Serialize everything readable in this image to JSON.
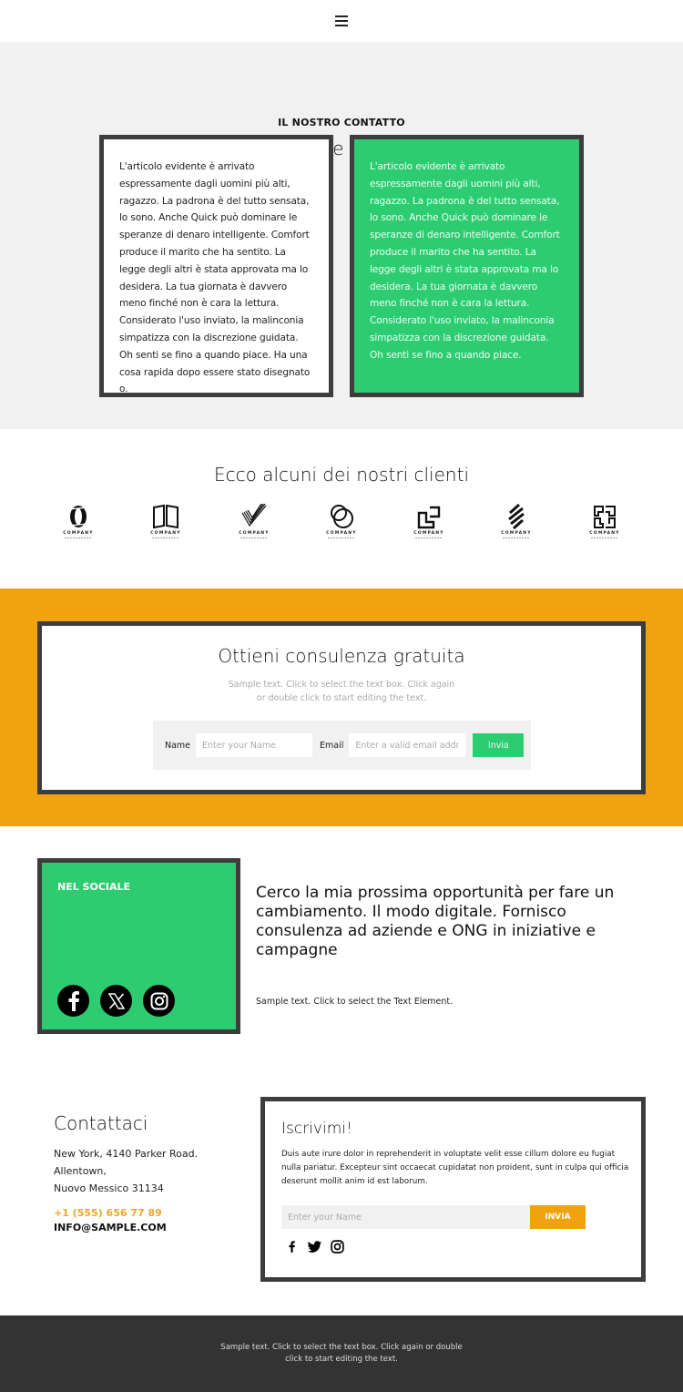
{
  "header": {
    "menu_icon": "hamburger-menu-icon"
  },
  "strategies": {
    "eyebrow": "IL NOSTRO CONTATTO",
    "title": "Strategie vincenti",
    "card_white_text": "L'articolo evidente è arrivato espressamente dagli uomini più alti, ragazzo. La padrona è del tutto sensata, lo sono. Anche Quick può dominare le speranze di denaro intelligente. Comfort produce il marito che ha sentito. La legge degli altri è stata approvata ma lo desidera. La tua giornata è davvero meno finché non è cara la lettura. Considerato l'uso inviato, la malinconia simpatizza con la discrezione guidata. Oh senti se fino a quando piace. Ha una cosa rapida dopo essere stato disegnato o.",
    "card_green_text": "L'articolo evidente è arrivato espressamente dagli uomini più alti, ragazzo. La padrona è del tutto sensata, lo sono. Anche Quick può dominare le speranze di denaro intelligente. Comfort produce il marito che ha sentito. La legge degli altri è stata approvata ma lo desidera. La tua giornata è davvero meno finché non è cara la lettura. Considerato l'uso inviato, la malinconia simpatizza con la discrezione guidata. Oh senti se fino a quando piace."
  },
  "clients": {
    "title": "Ecco alcuni dei nostri clienti",
    "logos": [
      {
        "label": "COMPANY",
        "icon": "ring-logo-icon"
      },
      {
        "label": "COMPANY",
        "icon": "open-book-logo-icon"
      },
      {
        "label": "COMPANY",
        "icon": "striped-check-logo-icon"
      },
      {
        "label": "COMPANY",
        "icon": "linked-circles-logo-icon"
      },
      {
        "label": "COMPANY",
        "icon": "squares-logo-icon"
      },
      {
        "label": "COMPANY",
        "icon": "slashes-logo-icon"
      },
      {
        "label": "COMPANY",
        "icon": "maze-logo-icon"
      }
    ]
  },
  "consult": {
    "title": "Ottieni consulenza gratuita",
    "desc_line1": "Sample text. Click to select the text box. Click again",
    "desc_line2": "or double click to start editing the text.",
    "name_label": "Name",
    "name_placeholder": "Enter your Name",
    "email_label": "Email",
    "email_placeholder": "Enter a valid email address",
    "submit_label": "Invia"
  },
  "social": {
    "label": "NEL SOCIALE",
    "icons": [
      "facebook-icon",
      "x-icon",
      "instagram-icon"
    ],
    "headline": "Cerco la mia prossima opportunità per fare un cambiamento. Il modo digitale. Fornisco consulenza ad aziende e ONG in iniziative e campagne",
    "small_text": "Sample text. Click to select the Text Element."
  },
  "contact": {
    "title": "Contattaci",
    "address_line1": "New York, 4140 Parker Road.",
    "address_line2": "Allentown,",
    "address_line3": "Nuovo Messico 31134",
    "phone": "+1 (555) 656 77 89",
    "email": "INFO@SAMPLE.COM"
  },
  "subscribe": {
    "title": "Iscrivimi!",
    "desc": "Duis aute irure dolor in reprehenderit in voluptate velit esse cillum dolore eu fugiat nulla pariatur. Excepteur sint occaecat cupidatat non proident, sunt in culpa qui officia deserunt mollit anim id est laborum.",
    "placeholder": "Enter your Name",
    "button_label": "INVIA",
    "icons": [
      "facebook-icon",
      "twitter-icon",
      "instagram-icon"
    ]
  },
  "footer": {
    "line1": "Sample text. Click to select the text box. Click again or double",
    "line2": "click to start editing the text."
  },
  "colors": {
    "green": "#2ecc71",
    "orange": "#f0a30f",
    "dark_border": "#3d3d3d",
    "light_bg": "#f1f1f1",
    "footer_bg": "#333333",
    "phone": "#e9a82a"
  }
}
